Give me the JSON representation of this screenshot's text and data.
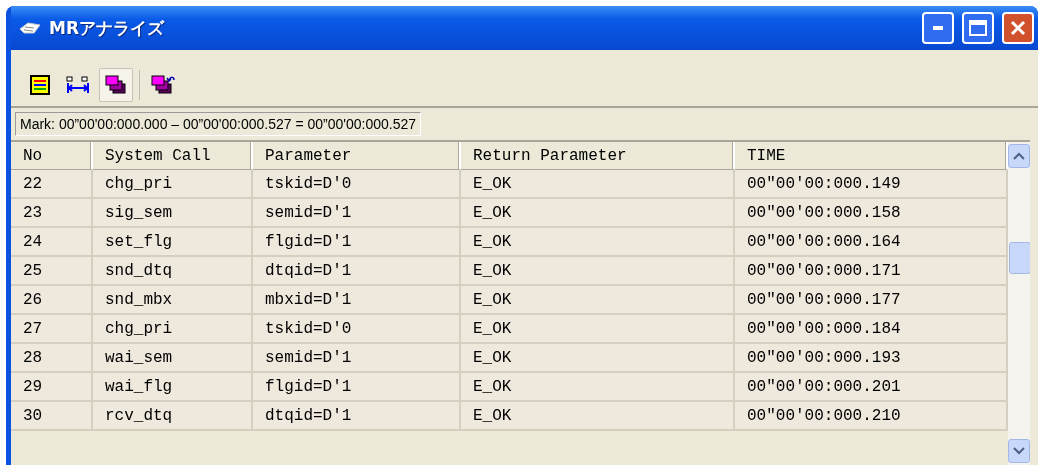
{
  "window": {
    "title": "MRアナライズ"
  },
  "toolbar": [
    {
      "kind": "chart",
      "selected": false
    },
    {
      "kind": "span",
      "selected": false
    },
    {
      "kind": "stack",
      "selected": true
    },
    {
      "kind": "stack-arrow",
      "selected": false
    }
  ],
  "mark": "Mark: 00”00'00:000.000 – 00”00'00:000.527 = 00”00'00:000.527",
  "table": {
    "columns": [
      "No",
      "System Call",
      "Parameter",
      "Return Parameter",
      "TIME"
    ],
    "rows": [
      [
        "22",
        "chg_pri",
        "tskid=D'0",
        "E_OK",
        "00\"00'00:000.149"
      ],
      [
        "23",
        "sig_sem",
        "semid=D'1",
        "E_OK",
        "00\"00'00:000.158"
      ],
      [
        "24",
        "set_flg",
        "flgid=D'1",
        "E_OK",
        "00\"00'00:000.164"
      ],
      [
        "25",
        "snd_dtq",
        "dtqid=D'1",
        "E_OK",
        "00\"00'00:000.171"
      ],
      [
        "26",
        "snd_mbx",
        "mbxid=D'1",
        "E_OK",
        "00\"00'00:000.177"
      ],
      [
        "27",
        "chg_pri",
        "tskid=D'0",
        "E_OK",
        "00\"00'00:000.184"
      ],
      [
        "28",
        "wai_sem",
        "semid=D'1",
        "E_OK",
        "00\"00'00:000.193"
      ],
      [
        "29",
        "wai_flg",
        "flgid=D'1",
        "E_OK",
        "00\"00'00:000.201"
      ],
      [
        "30",
        "rcv_dtq",
        "dtqid=D'1",
        "E_OK",
        "00\"00'00:000.210"
      ]
    ]
  }
}
